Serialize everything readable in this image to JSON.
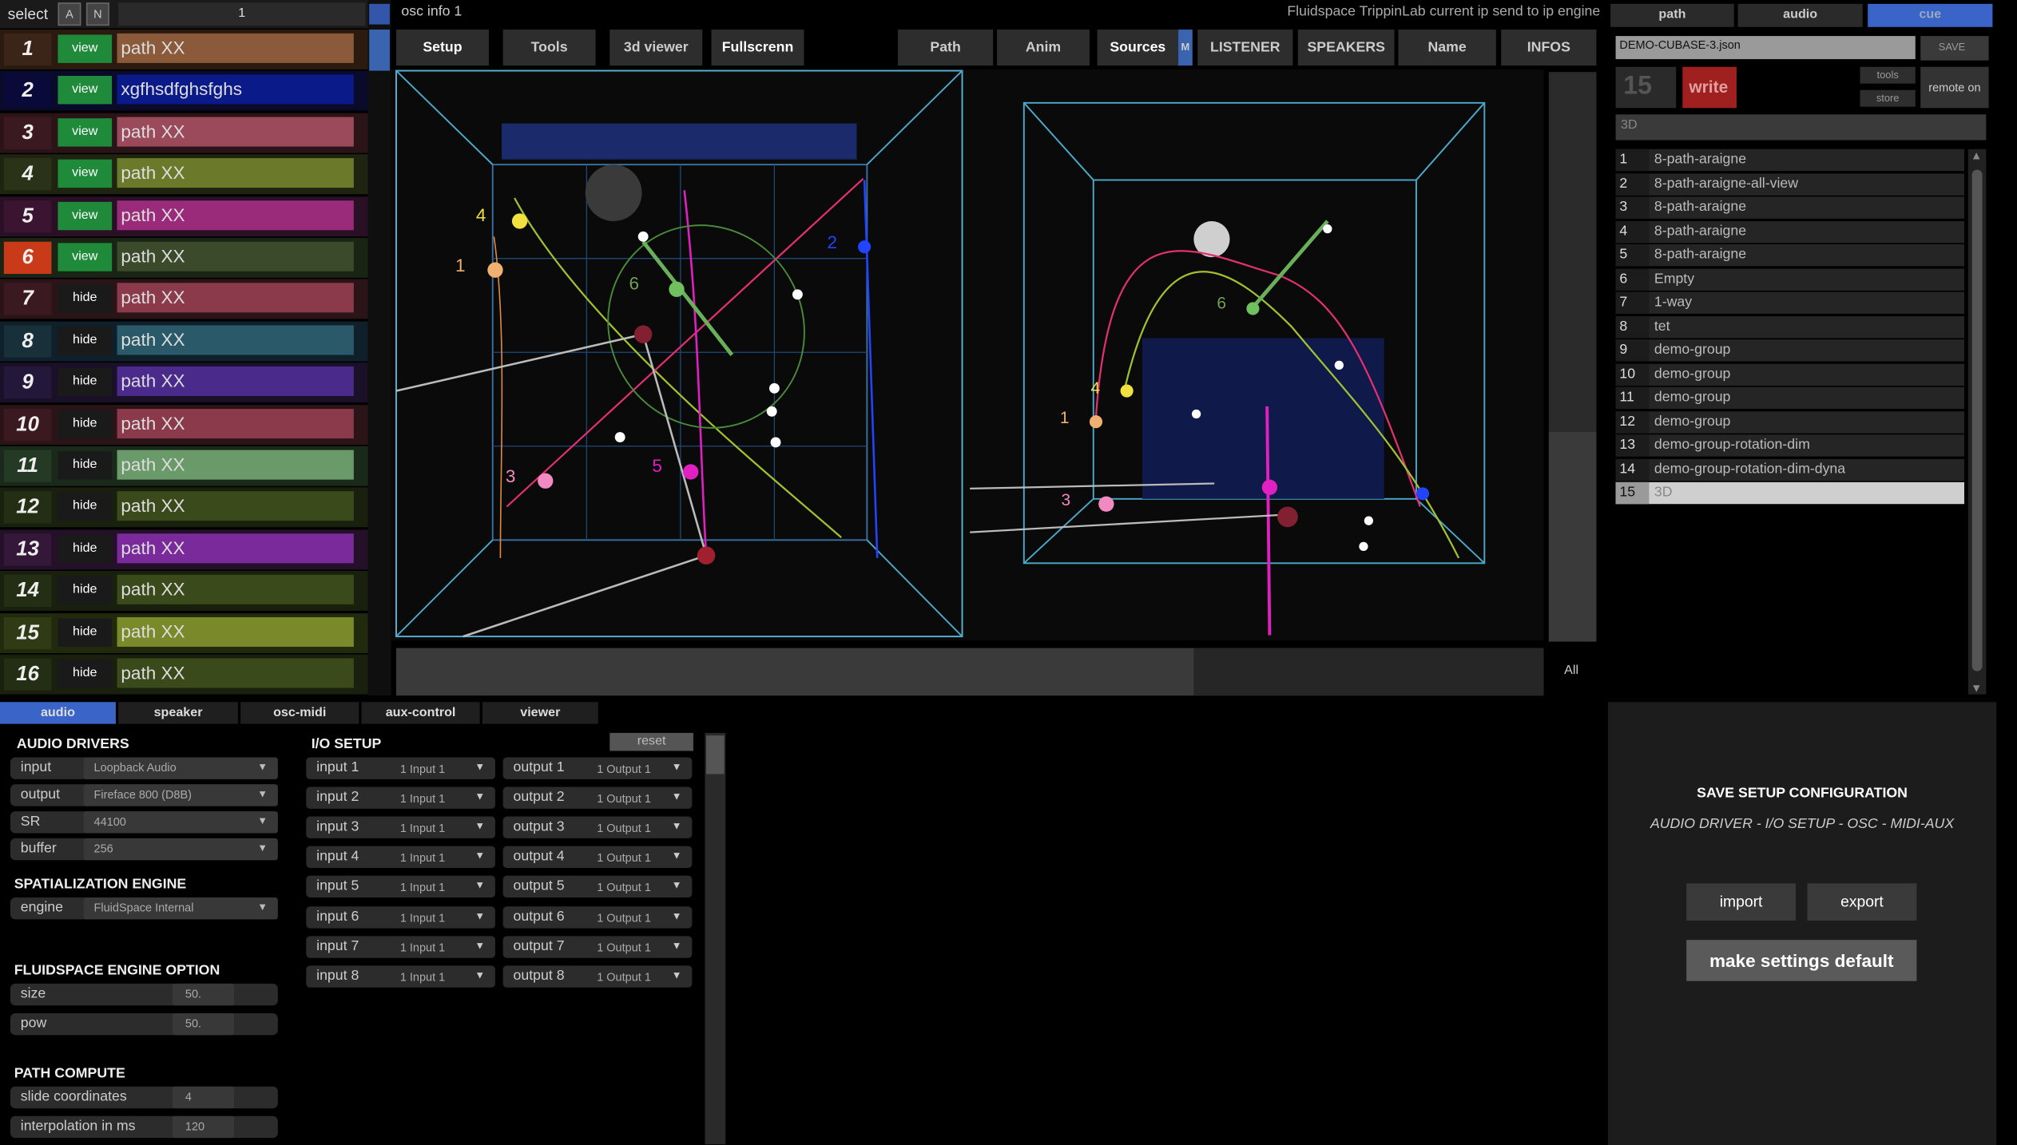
{
  "header": {
    "select_label": "select",
    "a_label": "A",
    "n_label": "N",
    "select_value": "1"
  },
  "sources": [
    {
      "num": "1",
      "btn": "view",
      "name": "path XX",
      "row": "#2a1a10",
      "numbg": "#3a2518",
      "namebg": "#8a5a3a",
      "btnbg": "#1e8a3a"
    },
    {
      "num": "2",
      "btn": "view",
      "name": "xgfhsdfghsfghs",
      "row": "#0a0a2a",
      "numbg": "#0a0a3a",
      "namebg": "#0a1a88",
      "btnbg": "#1e8a3a"
    },
    {
      "num": "3",
      "btn": "view",
      "name": "path XX",
      "row": "#2a1418",
      "numbg": "#3a1a20",
      "namebg": "#9a4a5a",
      "btnbg": "#1e8a3a"
    },
    {
      "num": "4",
      "btn": "view",
      "name": "path XX",
      "row": "#1e2410",
      "numbg": "#2a3218",
      "namebg": "#6a7a2a",
      "btnbg": "#1e8a3a"
    },
    {
      "num": "5",
      "btn": "view",
      "name": "path XX",
      "row": "#2a1024",
      "numbg": "#3a1430",
      "namebg": "#9a2a7a",
      "btnbg": "#1e8a3a"
    },
    {
      "num": "6",
      "btn": "view",
      "name": "path XX",
      "row": "#1a2414",
      "numbg": "#c83a18",
      "namebg": "#3a4a2a",
      "btnbg": "#1e8a3a"
    },
    {
      "num": "7",
      "btn": "hide",
      "name": "path XX",
      "row": "#2a1418",
      "numbg": "#3a1a20",
      "namebg": "#8a3a4a",
      "btnbg": "#1a1a1a"
    },
    {
      "num": "8",
      "btn": "hide",
      "name": "path XX",
      "row": "#10202a",
      "numbg": "#18303a",
      "namebg": "#2a5a6a",
      "btnbg": "#1a1a1a"
    },
    {
      "num": "9",
      "btn": "hide",
      "name": "path XX",
      "row": "#1a1028",
      "numbg": "#24183a",
      "namebg": "#4a2a8a",
      "btnbg": "#1a1a1a"
    },
    {
      "num": "10",
      "btn": "hide",
      "name": "path XX",
      "row": "#2a1418",
      "numbg": "#3a1a20",
      "namebg": "#8a3a4a",
      "btnbg": "#1a1a1a"
    },
    {
      "num": "11",
      "btn": "hide",
      "name": "path XX",
      "row": "#1a2a1a",
      "numbg": "#243a24",
      "namebg": "#6a9a6a",
      "btnbg": "#1a1a1a"
    },
    {
      "num": "12",
      "btn": "hide",
      "name": "path XX",
      "row": "#1a200e",
      "numbg": "#242e14",
      "namebg": "#3a4a1a",
      "btnbg": "#1a1a1a"
    },
    {
      "num": "13",
      "btn": "hide",
      "name": "path XX",
      "row": "#241028",
      "numbg": "#34183a",
      "namebg": "#7a2a9a",
      "btnbg": "#1a1a1a"
    },
    {
      "num": "14",
      "btn": "hide",
      "name": "path XX",
      "row": "#1a200e",
      "numbg": "#242e14",
      "namebg": "#3a4a1a",
      "btnbg": "#1a1a1a"
    },
    {
      "num": "15",
      "btn": "hide",
      "name": "path XX",
      "row": "#222a0e",
      "numbg": "#303a14",
      "namebg": "#7a8a2a",
      "btnbg": "#1a1a1a"
    },
    {
      "num": "16",
      "btn": "hide",
      "name": "path XX",
      "row": "#1a200e",
      "numbg": "#242e14",
      "namebg": "#3a4a1a",
      "btnbg": "#1a1a1a"
    }
  ],
  "top": {
    "osc_info": "osc info 1",
    "status": "Fluidspace TrippinLab current ip send to ip engine",
    "tools": [
      "Setup",
      "Tools",
      "3d viewer",
      "Fullscrenn"
    ],
    "tabs": [
      "Path",
      "Anim",
      "Sources",
      "M",
      "LISTENER",
      "SPEAKERS",
      "Name",
      "INFOS"
    ],
    "all_label": "All"
  },
  "viewer": {
    "labels_left": [
      "4",
      "1",
      "6",
      "2",
      "3",
      "5"
    ],
    "labels_right": [
      "6",
      "4",
      "1",
      "3"
    ]
  },
  "right": {
    "tabs": [
      "path",
      "audio",
      "cue"
    ],
    "file": "DEMO-CUBASE-3.json",
    "save": "SAVE",
    "cue_num": "15",
    "write": "write",
    "tools": "tools",
    "store": "store",
    "remote": "remote on",
    "cue_name": "3D",
    "cues": [
      {
        "n": "1",
        "t": "8-path-araigne"
      },
      {
        "n": "2",
        "t": "8-path-araigne-all-view"
      },
      {
        "n": "3",
        "t": "8-path-araigne"
      },
      {
        "n": "4",
        "t": "8-path-araigne"
      },
      {
        "n": "5",
        "t": "8-path-araigne"
      },
      {
        "n": "6",
        "t": "Empty"
      },
      {
        "n": "7",
        "t": "1-way"
      },
      {
        "n": "8",
        "t": "tet"
      },
      {
        "n": "9",
        "t": "demo-group"
      },
      {
        "n": "10",
        "t": "demo-group"
      },
      {
        "n": "11",
        "t": "demo-group"
      },
      {
        "n": "12",
        "t": "demo-group"
      },
      {
        "n": "13",
        "t": "demo-group-rotation-dim"
      },
      {
        "n": "14",
        "t": "demo-group-rotation-dim-dyna"
      },
      {
        "n": "15",
        "t": "3D"
      }
    ]
  },
  "bottom": {
    "tabs": [
      "audio",
      "speaker",
      "osc-midi",
      "aux-control",
      "viewer"
    ],
    "audio_drivers": "AUDIO DRIVERS",
    "drivers": [
      {
        "k": "input",
        "v": "Loopback Audio"
      },
      {
        "k": "output",
        "v": "Fireface 800 (D8B)"
      },
      {
        "k": "SR",
        "v": "44100"
      },
      {
        "k": "buffer",
        "v": "256"
      }
    ],
    "spat": "SPATIALIZATION ENGINE",
    "engine_k": "engine",
    "engine_v": "FluidSpace Internal",
    "fluid": "FLUIDSPACE ENGINE OPTION",
    "size_k": "size",
    "size_v": "50.",
    "pow_k": "pow",
    "pow_v": "50.",
    "path": "PATH COMPUTE",
    "slide_k": "slide coordinates",
    "slide_v": "4",
    "interp_k": "interpolation in ms",
    "interp_v": "120",
    "io_title": "I/O SETUP",
    "reset": "reset",
    "inputs": [
      {
        "k": "input 1",
        "v": "1 Input 1"
      },
      {
        "k": "input 2",
        "v": "1 Input 1"
      },
      {
        "k": "input 3",
        "v": "1 Input 1"
      },
      {
        "k": "input 4",
        "v": "1 Input 1"
      },
      {
        "k": "input 5",
        "v": "1 Input 1"
      },
      {
        "k": "input 6",
        "v": "1 Input 1"
      },
      {
        "k": "input 7",
        "v": "1 Input 1"
      },
      {
        "k": "input 8",
        "v": "1 Input 1"
      }
    ],
    "outputs": [
      {
        "k": "output 1",
        "v": "1 Output 1"
      },
      {
        "k": "output 2",
        "v": "1 Output 1"
      },
      {
        "k": "output 3",
        "v": "1 Output 1"
      },
      {
        "k": "output 4",
        "v": "1 Output 1"
      },
      {
        "k": "output 5",
        "v": "1 Output 1"
      },
      {
        "k": "output 6",
        "v": "1 Output 1"
      },
      {
        "k": "output 7",
        "v": "1 Output 1"
      },
      {
        "k": "output 8",
        "v": "1 Output 1"
      }
    ]
  },
  "save": {
    "title": "SAVE  SETUP CONFIGURATION",
    "sub": "AUDIO DRIVER - I/O SETUP - OSC - MIDI-AUX",
    "import": "import",
    "export": "export",
    "default": "make settings default"
  }
}
